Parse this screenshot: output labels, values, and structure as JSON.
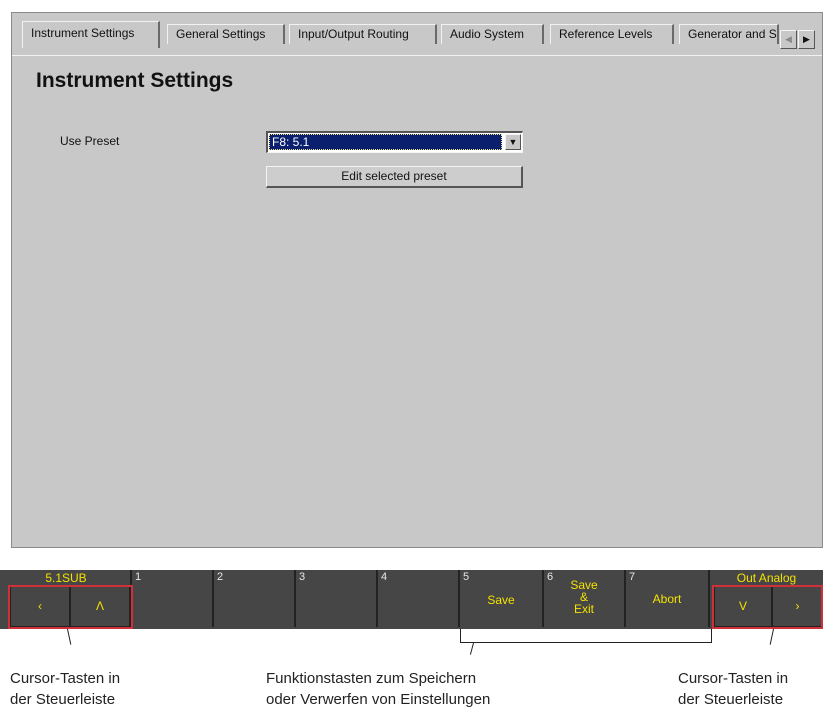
{
  "tabs": [
    {
      "label": "Instrument Settings",
      "active": true
    },
    {
      "label": "General Settings"
    },
    {
      "label": "Input/Output Routing"
    },
    {
      "label": "Audio System"
    },
    {
      "label": "Reference Levels"
    },
    {
      "label": "Generator and S"
    }
  ],
  "tab_scroll": {
    "left": "◀",
    "right": "▶"
  },
  "page": {
    "title": "Instrument Settings",
    "use_preset_label": "Use Preset",
    "preset_value": "F8: 5.1",
    "edit_button": "Edit selected preset",
    "dropdown_arrow": "▼"
  },
  "control_bar": {
    "left_status": "5.1SUB",
    "right_status": "Out Analog",
    "cursor_left": "‹",
    "cursor_up": "Λ",
    "cursor_down": "V",
    "cursor_right": "›",
    "keys": [
      {
        "num": "1",
        "label": ""
      },
      {
        "num": "2",
        "label": ""
      },
      {
        "num": "3",
        "label": ""
      },
      {
        "num": "4",
        "label": ""
      },
      {
        "num": "5",
        "label": "Save"
      },
      {
        "num": "6",
        "label_line1": "Save",
        "label_line2": "&",
        "label_line3": "Exit"
      },
      {
        "num": "7",
        "label": "Abort"
      }
    ]
  },
  "captions": {
    "left_line1": "Cursor-Tasten in",
    "left_line2": "der Steuerleiste",
    "middle_line1": "Funktionstasten zum Speichern",
    "middle_line2": "oder Verwerfen von Einstellungen",
    "right_line1": "Cursor-Tasten in",
    "right_line2": "der Steuerleiste"
  },
  "colors": {
    "highlight": "#d0303a",
    "bar_text": "#f4e200",
    "selection": "#0a1f6e"
  }
}
